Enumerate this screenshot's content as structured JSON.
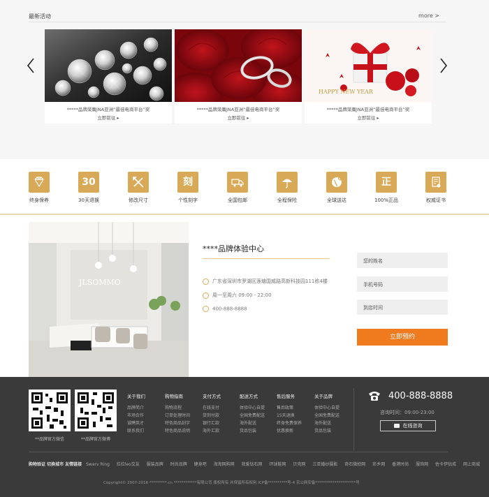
{
  "promo": {
    "title": "最新活动",
    "more": "more >",
    "cards": [
      {
        "caption": "*****品牌荣膺JNA亚洲“最佳电商平台”奖",
        "link": "立即前往 ▸"
      },
      {
        "caption": "*****品牌荣膺JNA亚洲“最佳电商平台”奖",
        "link": "立即前往 ▸"
      },
      {
        "caption": "*****品牌荣膺JNA亚洲“最佳电商平台”奖",
        "link": "立即前往 ▸"
      }
    ],
    "card3_text": "HAPPY NEW YEAR"
  },
  "services": [
    {
      "label": "终身保养",
      "icon": "diamond-icon",
      "glyph": ""
    },
    {
      "label": "30天退换",
      "icon": "thirty-days-icon",
      "glyph": "30"
    },
    {
      "label": "修改尺寸",
      "icon": "tools-icon",
      "glyph": ""
    },
    {
      "label": "个性刻字",
      "icon": "engrave-icon",
      "glyph": "刻"
    },
    {
      "label": "全国包邮",
      "icon": "truck-icon",
      "glyph": ""
    },
    {
      "label": "全程保险",
      "icon": "umbrella-icon",
      "glyph": ""
    },
    {
      "label": "全球送达",
      "icon": "globe-icon",
      "glyph": ""
    },
    {
      "label": "100%正品",
      "icon": "genuine-icon",
      "glyph": "正"
    },
    {
      "label": "权威证书",
      "icon": "certificate-icon",
      "glyph": ""
    }
  ],
  "store": {
    "title": "****品牌体验中心",
    "address": "广东省深圳市罗湖区莲塘国威路高新科技园111栋4楼",
    "hours": "周一至周六 09:00 - 22:00",
    "phone": "400-888-8888",
    "sign": "JLSOMMO",
    "form": {
      "name_placeholder": "您的姓名",
      "phone_placeholder": "手机号码",
      "time_placeholder": "到店时间",
      "submit": "立即预约"
    }
  },
  "footer": {
    "qr1_caption": "**品牌官方微信",
    "qr2_caption": "**品牌官方微博",
    "columns": [
      {
        "title": "关于我们",
        "items": [
          "品牌简介",
          "市场合作",
          "诚聘英才",
          "联系我们"
        ]
      },
      {
        "title": "购物指南",
        "items": [
          "购物流程",
          "订单处理时间",
          "特色商品刻字",
          "特色商品说明"
        ]
      },
      {
        "title": "支付方式",
        "items": [
          "在线支付",
          "货到付款",
          "银行汇款",
          "海外汇款"
        ]
      },
      {
        "title": "配送方式",
        "items": [
          "体验中心自提",
          "全国免费配送",
          "海外配送",
          "货品包装"
        ]
      },
      {
        "title": "售后服务",
        "items": [
          "售后政策",
          "15天退换",
          "终身免费保养",
          "优惠换新"
        ]
      },
      {
        "title": "关于品牌",
        "items": [
          "体验中心自提",
          "全国免费配送",
          "海外配送",
          "货品包装"
        ]
      }
    ],
    "phone": "400-888-8888",
    "hours": "咨询时间：09:00-23:00",
    "chat": "在线咨询",
    "links_label": "购物验证  切换城市  友情链接",
    "links": [
      "Swarv Ring",
      "拉拉leo交友",
      "服装品牌",
      "时尚品牌",
      "健身吧",
      "海淘网购网",
      "我爱钻石网",
      "环球鞋网",
      "贝壳网",
      "三亚婚纱摄影",
      "奇石微拍网",
      "彩乡网",
      "香港时尚",
      "服饰网",
      "佐卡伊钻戒",
      "网上商城"
    ],
    "copyright": "Copyright© 2007-2016  *********.cn  ************有限公司 版权所有 并保留所有权利 ICP备**********号-4 京公网安备*********************号"
  },
  "colors": {
    "gold": "#d8aa58",
    "orange": "#f07a1e",
    "footer_bg": "#3a3a3a"
  }
}
